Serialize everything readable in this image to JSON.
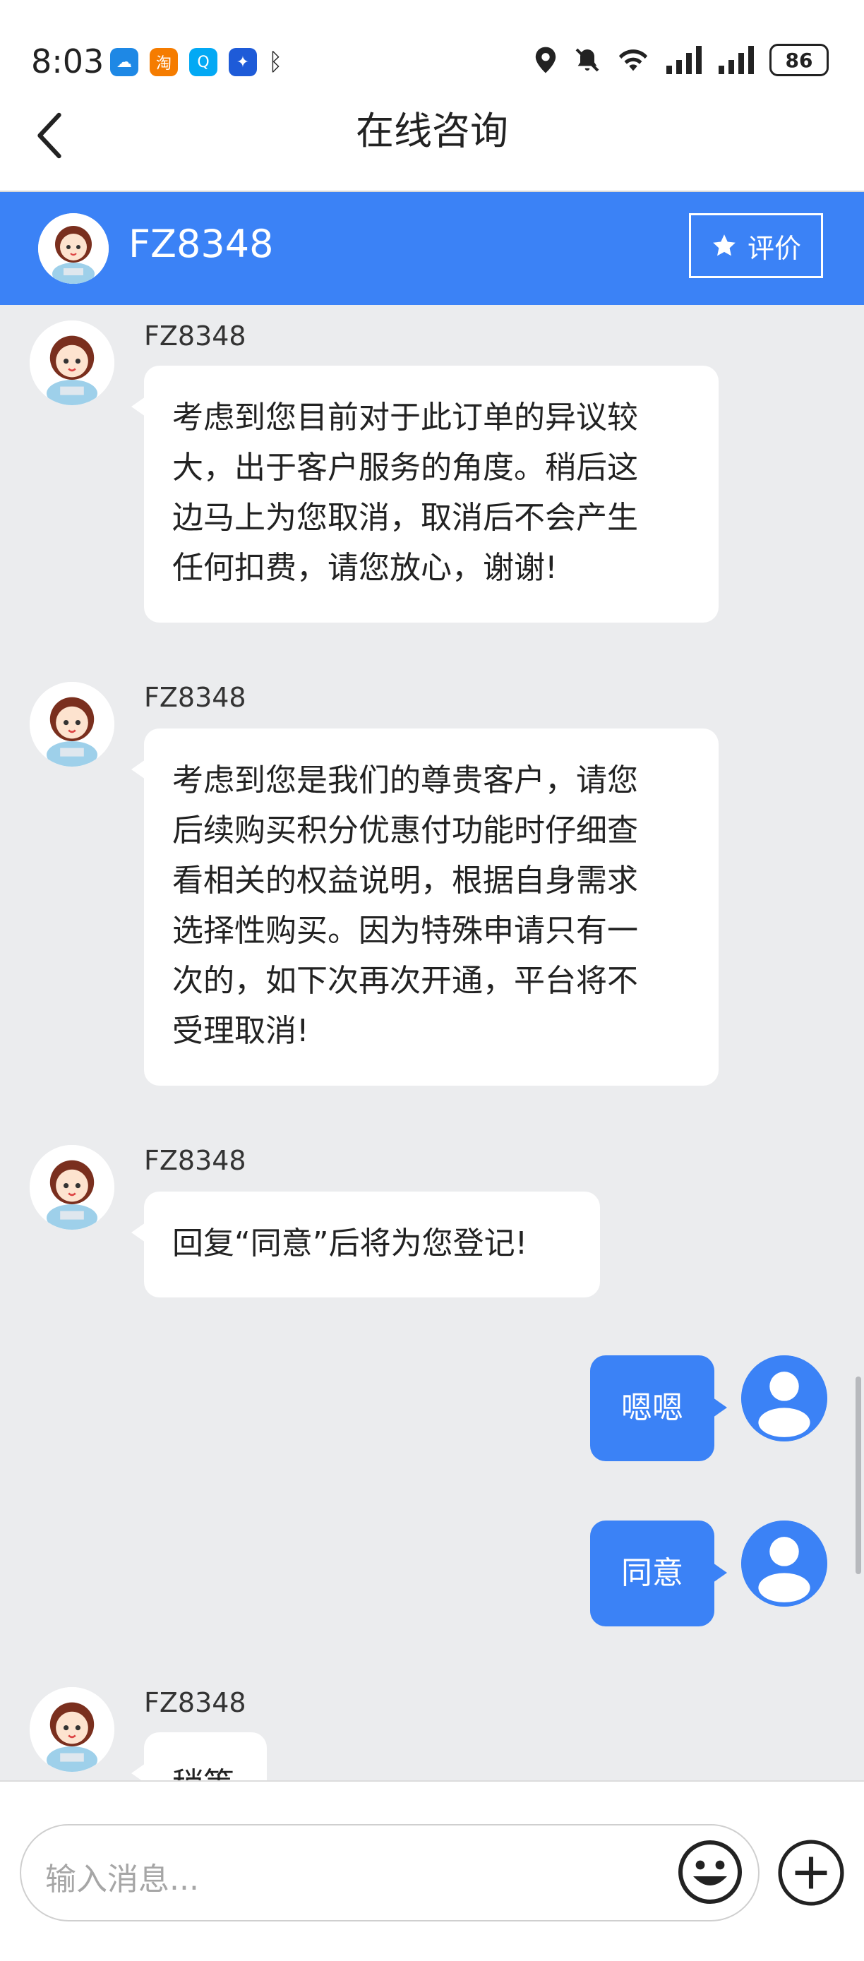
{
  "status_bar": {
    "time": "8:03",
    "app_icons": [
      {
        "name": "weather",
        "glyph": "☁",
        "color": "#1e88e5"
      },
      {
        "name": "taobao",
        "glyph": "淘",
        "color": "#f57c00"
      },
      {
        "name": "search",
        "glyph": "Q",
        "color": "#03a9f4"
      },
      {
        "name": "bulb",
        "glyph": "✦",
        "color": "#1e5bd8"
      }
    ],
    "battery": "86"
  },
  "header": {
    "title": "在线咨询"
  },
  "agent_bar": {
    "name": "FZ8348",
    "rate_label": "评价"
  },
  "messages": [
    {
      "sender": "FZ8348",
      "lines": [
        "考虑到您目前对于此订单的异议较",
        "大，出于客户服务的角度。稍后这",
        "边马上为您取消，取消后不会产生",
        "任何扣费，请您放心，谢谢!"
      ]
    },
    {
      "sender": "FZ8348",
      "lines": [
        "考虑到您是我们的尊贵客户，请您",
        "后续购买积分优惠付功能时仔细查",
        "看相关的权益说明，根据自身需求",
        "选择性购买。因为特殊申请只有一",
        "次的，如下次再次开通，平台将不",
        "受理取消!"
      ]
    },
    {
      "sender": "FZ8348",
      "lines": [
        "回复“同意”后将为您登记!"
      ]
    },
    {
      "sender": "me",
      "text": "嗯嗯"
    },
    {
      "sender": "me",
      "text": "同意"
    },
    {
      "sender": "FZ8348",
      "lines": [
        "稍等"
      ]
    }
  ],
  "input": {
    "placeholder": "输入消息..."
  },
  "colors": {
    "accent": "#3b82f6",
    "background": "#ebecee"
  }
}
